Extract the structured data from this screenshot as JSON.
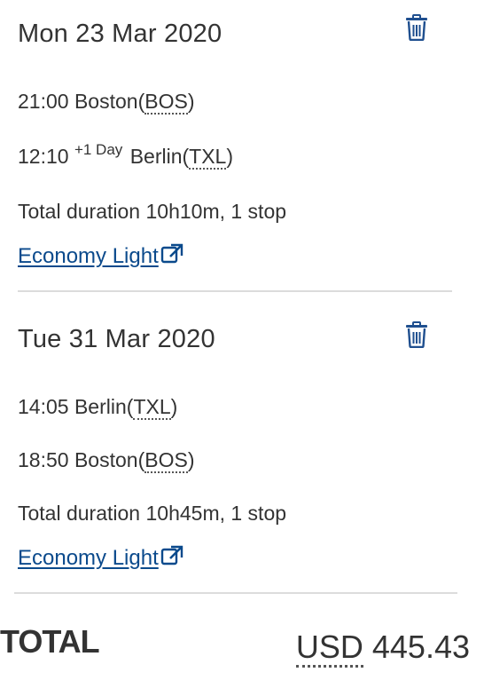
{
  "segments": [
    {
      "date": "Mon 23 Mar 2020",
      "departure": {
        "time": "21:00",
        "city": "Boston",
        "code": "BOS"
      },
      "arrival": {
        "time": "12:10",
        "day_offset": "+1 Day",
        "city": "Berlin",
        "code": "TXL"
      },
      "duration": "Total duration 10h10m, 1 stop",
      "fare_link": "Economy Light"
    },
    {
      "date": "Tue 31 Mar 2020",
      "departure": {
        "time": "14:05",
        "city": "Berlin",
        "code": "TXL"
      },
      "arrival": {
        "time": "18:50",
        "city": "Boston",
        "code": "BOS"
      },
      "duration": "Total duration 10h45m, 1 stop",
      "fare_link": "Economy Light"
    }
  ],
  "total": {
    "label": "TOTAL",
    "currency": "USD",
    "amount": "445.43"
  },
  "icons": {
    "delete": "trash-icon",
    "external_link": "external-link-icon"
  },
  "colors": {
    "link": "#0b4a8c",
    "text": "#333333",
    "divider": "#dcdcdc"
  }
}
